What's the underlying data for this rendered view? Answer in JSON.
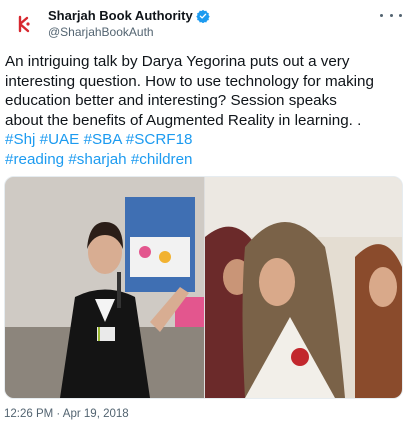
{
  "author": {
    "display_name": "Sharjah Book Authority",
    "handle": "@SharjahBookAuth",
    "verified": true,
    "avatar_icon": "sba-logo-icon",
    "brand_color": "#d7282f"
  },
  "tweet": {
    "text_lines": [
      "An intriguing talk by Darya Yegorina puts out a very",
      "interesting question. How to use technology for making",
      "education better and interesting? Session speaks",
      "about the benefits of Augmented Reality in learning. ."
    ],
    "hashtags": [
      "#Shj",
      "#UAE",
      "#SBA",
      "#SCRF18",
      "#reading",
      "#sharjah",
      "#children"
    ],
    "link_color": "#1d9bf0"
  },
  "media": {
    "photo_count": 2,
    "photo_left_icon": "speaker-photo",
    "photo_right_icon": "audience-photo"
  },
  "meta": {
    "timestamp": "12:26 PM · Apr 19, 2018"
  },
  "icons": {
    "more": "more-options-icon",
    "verified": "verified-badge-icon"
  }
}
